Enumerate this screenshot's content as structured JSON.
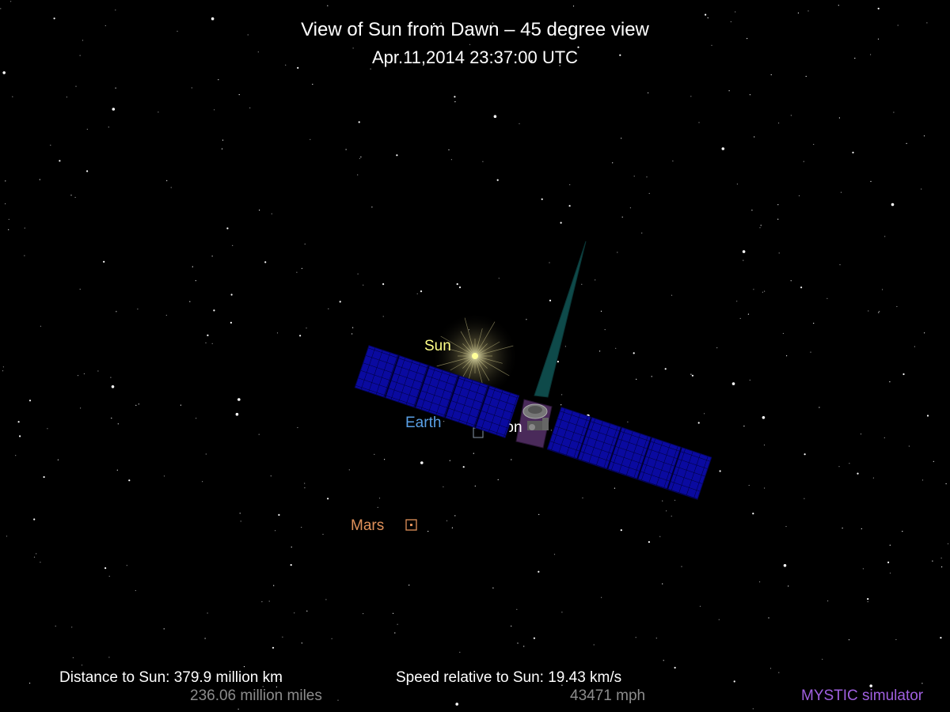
{
  "header": {
    "title": "View of Sun from Dawn – 45 degree view",
    "datetime": "Apr.11,2014 23:37:00  UTC"
  },
  "bodies": {
    "sun": "Sun",
    "earth": "Earth",
    "moon": "Moon",
    "mars": "Mars"
  },
  "stats": {
    "distance_label": "Distance to Sun: 379.9 million km",
    "distance_miles": "236.06 million miles",
    "speed_label": "Speed relative to Sun: 19.43 km/s",
    "speed_mph": "43471 mph"
  },
  "brand": "MYSTIC simulator",
  "colors": {
    "background": "#000000",
    "text": "#ffffff",
    "secondary_text": "#8c8c8c",
    "sun": "#ffff88",
    "earth": "#5aa0e6",
    "mars": "#e0915a",
    "moon": "#ffffff",
    "brand": "#a060e0",
    "solar_panel": "#0a0aa0",
    "antenna": "#0e4a4a",
    "spacecraft_body": "#4a2a5a"
  }
}
